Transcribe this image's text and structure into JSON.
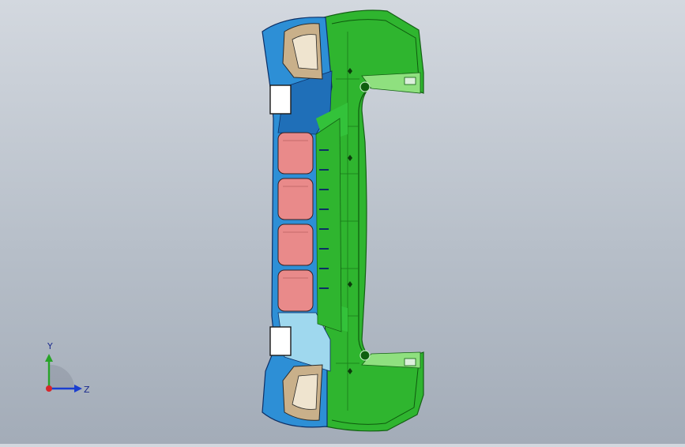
{
  "viewport": {
    "model_name": "bumper-part",
    "background_top": "#d3d8df",
    "background_bottom": "#a3acb8",
    "colors": {
      "shell": "#2fb52f",
      "shell_dark": "#1f8f1f",
      "inner_blue": "#2d8fd6",
      "light_blue": "#9fd8ee",
      "pink": "#e98a8a",
      "tan": "#c9b08a"
    }
  },
  "triad": {
    "y_label": "Y",
    "z_label": "Z",
    "x_color": "#d8262a",
    "y_color": "#28a428",
    "z_color": "#1a3ed0"
  }
}
